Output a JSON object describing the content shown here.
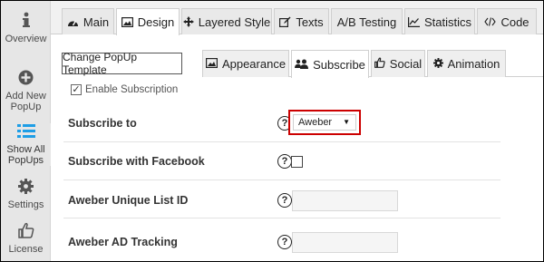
{
  "sidebar": {
    "items": [
      {
        "label": "Overview"
      },
      {
        "label": "Add New PopUp"
      },
      {
        "label": "Show All PopUps"
      },
      {
        "label": "Settings"
      },
      {
        "label": "License"
      }
    ]
  },
  "top_tabs": [
    {
      "label": "Main"
    },
    {
      "label": "Design"
    },
    {
      "label": "Layered Style"
    },
    {
      "label": "Texts"
    },
    {
      "label": "A/B Testing"
    },
    {
      "label": "Statistics"
    },
    {
      "label": "Code"
    }
  ],
  "change_template_label": "Change PopUp Template",
  "sub_tabs": [
    {
      "label": "Appearance"
    },
    {
      "label": "Subscribe"
    },
    {
      "label": "Social"
    },
    {
      "label": "Animation"
    }
  ],
  "enable_subscription": {
    "label": "Enable Subscription",
    "checked": true
  },
  "form": {
    "subscribe_to": {
      "label": "Subscribe to",
      "value": "Aweber"
    },
    "subscribe_facebook": {
      "label": "Subscribe with Facebook"
    },
    "aweber_list_id": {
      "label": "Aweber Unique List ID",
      "value": ""
    },
    "aweber_ad_tracking": {
      "label": "Aweber AD Tracking",
      "value": ""
    }
  },
  "help_glyph": "?",
  "check_glyph": "✓",
  "colors": {
    "highlight": "#cc0000",
    "sidebar_bg": "#e6e6e6",
    "active_icon": "#1e9ee6"
  }
}
